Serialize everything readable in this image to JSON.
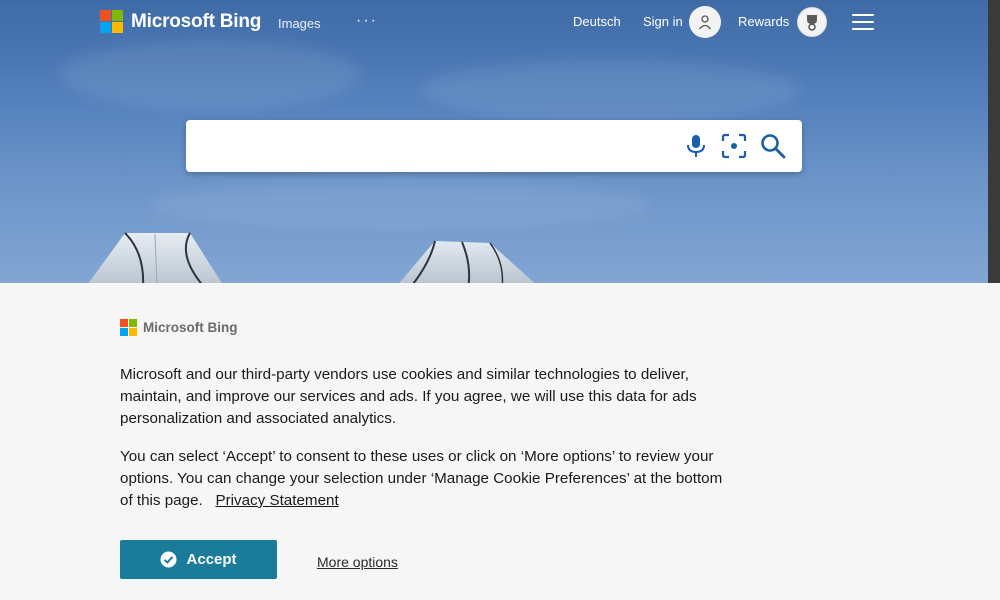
{
  "header": {
    "brand": "Microsoft Bing",
    "nav": {
      "images": "Images",
      "more": "···"
    },
    "language": "Deutsch",
    "sign_in": "Sign in",
    "rewards": "Rewards"
  },
  "search": {
    "value": "",
    "placeholder": ""
  },
  "icons": {
    "microphone": "microphone-icon",
    "visual_search": "visual-search-icon",
    "search": "search-icon",
    "account": "account-icon",
    "rewards": "rewards-trophy-icon",
    "menu": "hamburger-menu-icon",
    "accept_check": "checkmark-circle-icon"
  },
  "cookie_banner": {
    "brand": "Microsoft Bing",
    "paragraph1": "Microsoft and our third-party vendors use cookies and similar technologies to deliver, maintain, and improve our services and ads. If you agree, we will use this data for ads personalization and associated analytics.",
    "paragraph2": "You can select ‘Accept’ to consent to these uses or click on ‘More options’ to review your options.  You can change your selection under ‘Manage Cookie Preferences’ at the bottom of this page.",
    "privacy_link": "Privacy Statement",
    "accept_label": "Accept",
    "more_options_label": "More options"
  },
  "colors": {
    "accept_button": "#1b7c99",
    "sky_top": "#3e6aa6",
    "sky_bottom": "#82a6d3",
    "banner_bg": "#f6f6f6"
  }
}
